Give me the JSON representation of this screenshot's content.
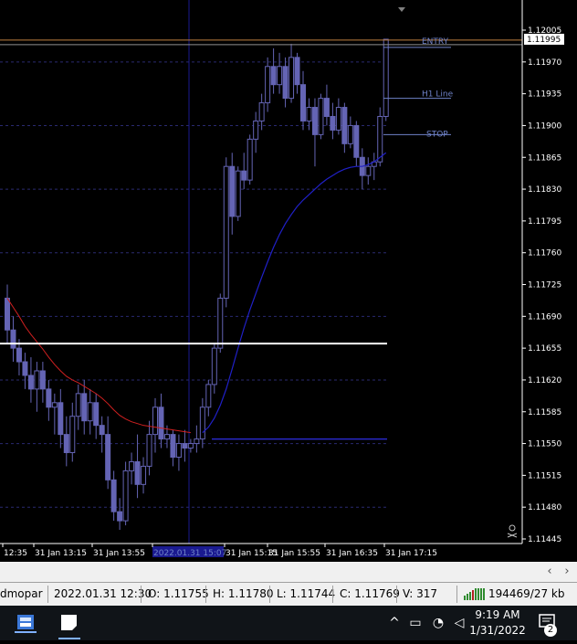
{
  "price_axis": {
    "labels": [
      "1.12005",
      "1.11970",
      "1.11935",
      "1.11900",
      "1.11865",
      "1.11830",
      "1.11795",
      "1.11760",
      "1.11725",
      "1.11690",
      "1.11655",
      "1.11620",
      "1.11585",
      "1.11550",
      "1.11515",
      "1.11480",
      "1.11445"
    ],
    "current_price": "1.11995"
  },
  "time_axis": {
    "labels": [
      "12:35",
      "31 Jan 13:15",
      "31 Jan 13:55",
      "2022.01.31 15:07",
      "31 Jan 15:15",
      "31 Jan 15:55",
      "31 Jan 16:35",
      "31 Jan 17:15"
    ]
  },
  "lines": {
    "entry": "ENTRY",
    "h1": "H1 Line",
    "stop": "STOP"
  },
  "status_bar": {
    "profile": "dmopar",
    "datetime": "2022.01.31 12:30",
    "open": "O: 1.11755",
    "high": "H: 1.11780",
    "low": "L: 1.11744",
    "close": "C: 1.11769",
    "volume": "V: 317",
    "traffic": "194469/27 kb"
  },
  "taskbar": {
    "time": "9:19 AM",
    "date": "1/31/2022",
    "notification_count": "2"
  },
  "colors": {
    "background": "#000000",
    "candle": "#6464b4",
    "grid": "#2a2a70",
    "ma_red": "#d02020",
    "ma_blue": "#2020c8",
    "axis_text": "#ffffff",
    "line_label": "#6f82c8",
    "entry_line": "#c08040"
  },
  "chart_data": {
    "type": "candlestick",
    "ylim": [
      1.1143,
      1.1203
    ],
    "bars": [
      {
        "o": 1.1171,
        "h": 1.11725,
        "l": 1.1166,
        "c": 1.11675
      },
      {
        "o": 1.11675,
        "h": 1.1169,
        "l": 1.1164,
        "c": 1.11655
      },
      {
        "o": 1.11655,
        "h": 1.11665,
        "l": 1.11625,
        "c": 1.1164
      },
      {
        "o": 1.1164,
        "h": 1.1165,
        "l": 1.1161,
        "c": 1.11625
      },
      {
        "o": 1.11625,
        "h": 1.11645,
        "l": 1.11595,
        "c": 1.1161
      },
      {
        "o": 1.1161,
        "h": 1.1164,
        "l": 1.11585,
        "c": 1.1163
      },
      {
        "o": 1.1163,
        "h": 1.1164,
        "l": 1.11595,
        "c": 1.1161
      },
      {
        "o": 1.1161,
        "h": 1.1162,
        "l": 1.11575,
        "c": 1.1159
      },
      {
        "o": 1.1159,
        "h": 1.11605,
        "l": 1.1156,
        "c": 1.11595
      },
      {
        "o": 1.11595,
        "h": 1.1161,
        "l": 1.11545,
        "c": 1.1156
      },
      {
        "o": 1.1156,
        "h": 1.1158,
        "l": 1.11525,
        "c": 1.1154
      },
      {
        "o": 1.1154,
        "h": 1.11595,
        "l": 1.1153,
        "c": 1.1158
      },
      {
        "o": 1.1158,
        "h": 1.11615,
        "l": 1.11565,
        "c": 1.11605
      },
      {
        "o": 1.11605,
        "h": 1.1162,
        "l": 1.1156,
        "c": 1.11575
      },
      {
        "o": 1.11575,
        "h": 1.1161,
        "l": 1.1156,
        "c": 1.11595
      },
      {
        "o": 1.11595,
        "h": 1.11605,
        "l": 1.11555,
        "c": 1.1157
      },
      {
        "o": 1.1157,
        "h": 1.1158,
        "l": 1.1154,
        "c": 1.1156
      },
      {
        "o": 1.1156,
        "h": 1.1158,
        "l": 1.115,
        "c": 1.1151
      },
      {
        "o": 1.1151,
        "h": 1.1152,
        "l": 1.11465,
        "c": 1.11475
      },
      {
        "o": 1.11475,
        "h": 1.1149,
        "l": 1.11455,
        "c": 1.11465
      },
      {
        "o": 1.11465,
        "h": 1.1153,
        "l": 1.1146,
        "c": 1.1152
      },
      {
        "o": 1.1152,
        "h": 1.1154,
        "l": 1.11505,
        "c": 1.1153
      },
      {
        "o": 1.1153,
        "h": 1.1156,
        "l": 1.1149,
        "c": 1.11505
      },
      {
        "o": 1.11505,
        "h": 1.11535,
        "l": 1.11495,
        "c": 1.11525
      },
      {
        "o": 1.11525,
        "h": 1.11575,
        "l": 1.11515,
        "c": 1.1156
      },
      {
        "o": 1.1156,
        "h": 1.116,
        "l": 1.1154,
        "c": 1.1159
      },
      {
        "o": 1.1159,
        "h": 1.11605,
        "l": 1.11545,
        "c": 1.11555
      },
      {
        "o": 1.11555,
        "h": 1.1157,
        "l": 1.11545,
        "c": 1.1156
      },
      {
        "o": 1.1156,
        "h": 1.11565,
        "l": 1.11525,
        "c": 1.11535
      },
      {
        "o": 1.11535,
        "h": 1.1156,
        "l": 1.1152,
        "c": 1.1155
      },
      {
        "o": 1.1155,
        "h": 1.11565,
        "l": 1.1153,
        "c": 1.11545
      },
      {
        "o": 1.11545,
        "h": 1.11555,
        "l": 1.1154,
        "c": 1.1155
      },
      {
        "o": 1.1155,
        "h": 1.1157,
        "l": 1.1154,
        "c": 1.11555
      },
      {
        "o": 1.11555,
        "h": 1.116,
        "l": 1.11545,
        "c": 1.1159
      },
      {
        "o": 1.1159,
        "h": 1.1162,
        "l": 1.1158,
        "c": 1.11615
      },
      {
        "o": 1.11615,
        "h": 1.1166,
        "l": 1.11605,
        "c": 1.11655
      },
      {
        "o": 1.11655,
        "h": 1.11715,
        "l": 1.1165,
        "c": 1.1171
      },
      {
        "o": 1.1171,
        "h": 1.11865,
        "l": 1.117,
        "c": 1.11855
      },
      {
        "o": 1.11855,
        "h": 1.1187,
        "l": 1.1178,
        "c": 1.118
      },
      {
        "o": 1.118,
        "h": 1.11855,
        "l": 1.11795,
        "c": 1.1185
      },
      {
        "o": 1.1185,
        "h": 1.1187,
        "l": 1.1183,
        "c": 1.1184
      },
      {
        "o": 1.1184,
        "h": 1.1189,
        "l": 1.11835,
        "c": 1.11885
      },
      {
        "o": 1.11885,
        "h": 1.11915,
        "l": 1.1187,
        "c": 1.11905
      },
      {
        "o": 1.11905,
        "h": 1.11935,
        "l": 1.11895,
        "c": 1.11925
      },
      {
        "o": 1.11925,
        "h": 1.11975,
        "l": 1.11915,
        "c": 1.11965
      },
      {
        "o": 1.11965,
        "h": 1.11985,
        "l": 1.11935,
        "c": 1.11945
      },
      {
        "o": 1.11945,
        "h": 1.1198,
        "l": 1.11935,
        "c": 1.11965
      },
      {
        "o": 1.11965,
        "h": 1.11975,
        "l": 1.1192,
        "c": 1.1193
      },
      {
        "o": 1.1193,
        "h": 1.1199,
        "l": 1.11925,
        "c": 1.11975
      },
      {
        "o": 1.11975,
        "h": 1.1198,
        "l": 1.11935,
        "c": 1.11945
      },
      {
        "o": 1.11945,
        "h": 1.1196,
        "l": 1.11895,
        "c": 1.11905
      },
      {
        "o": 1.11905,
        "h": 1.1193,
        "l": 1.11895,
        "c": 1.1192
      },
      {
        "o": 1.1192,
        "h": 1.1193,
        "l": 1.11855,
        "c": 1.1189
      },
      {
        "o": 1.1189,
        "h": 1.11935,
        "l": 1.11885,
        "c": 1.1193
      },
      {
        "o": 1.1193,
        "h": 1.11945,
        "l": 1.119,
        "c": 1.1191
      },
      {
        "o": 1.1191,
        "h": 1.11925,
        "l": 1.11885,
        "c": 1.11895
      },
      {
        "o": 1.11895,
        "h": 1.1193,
        "l": 1.1189,
        "c": 1.1192
      },
      {
        "o": 1.1192,
        "h": 1.11925,
        "l": 1.1187,
        "c": 1.1188
      },
      {
        "o": 1.1188,
        "h": 1.1191,
        "l": 1.11875,
        "c": 1.119
      },
      {
        "o": 1.119,
        "h": 1.11905,
        "l": 1.11855,
        "c": 1.11865
      },
      {
        "o": 1.11865,
        "h": 1.11875,
        "l": 1.1183,
        "c": 1.11845
      },
      {
        "o": 1.11845,
        "h": 1.11865,
        "l": 1.11835,
        "c": 1.11855
      },
      {
        "o": 1.11855,
        "h": 1.1187,
        "l": 1.1184,
        "c": 1.1186
      },
      {
        "o": 1.1186,
        "h": 1.1192,
        "l": 1.11855,
        "c": 1.1191
      },
      {
        "o": 1.1191,
        "h": 1.11995,
        "l": 1.11905,
        "c": 1.11995
      }
    ],
    "ma_red": [
      1.1171,
      1.117,
      1.1169,
      1.11679,
      1.1167,
      1.11662,
      1.11654,
      1.11645,
      1.11637,
      1.1163,
      1.11624,
      1.1162,
      1.11617,
      1.11613,
      1.11609,
      1.11605,
      1.116,
      1.11594,
      1.11587,
      1.11581,
      1.11577,
      1.11574,
      1.11572,
      1.1157,
      1.11569,
      1.11568,
      1.11567,
      1.11566,
      1.11565,
      1.11564,
      1.11563,
      1.11562
    ],
    "ma_blue": [
      1.11562,
      1.11568,
      1.11578,
      1.11592,
      1.1161,
      1.11632,
      1.11655,
      1.11677,
      1.11697,
      1.11715,
      1.11733,
      1.1175,
      1.11766,
      1.1178,
      1.11792,
      1.11802,
      1.11811,
      1.11818,
      1.11824,
      1.1183,
      1.11836,
      1.11841,
      1.11845,
      1.11849,
      1.11852,
      1.11854,
      1.11855,
      1.11855,
      1.11857,
      1.1186,
      1.11865,
      1.1187
    ],
    "levels": {
      "entry": 1.1199,
      "h1": 1.1193,
      "stop": 1.1189,
      "white": 1.1166,
      "blue": 1.11555
    }
  }
}
